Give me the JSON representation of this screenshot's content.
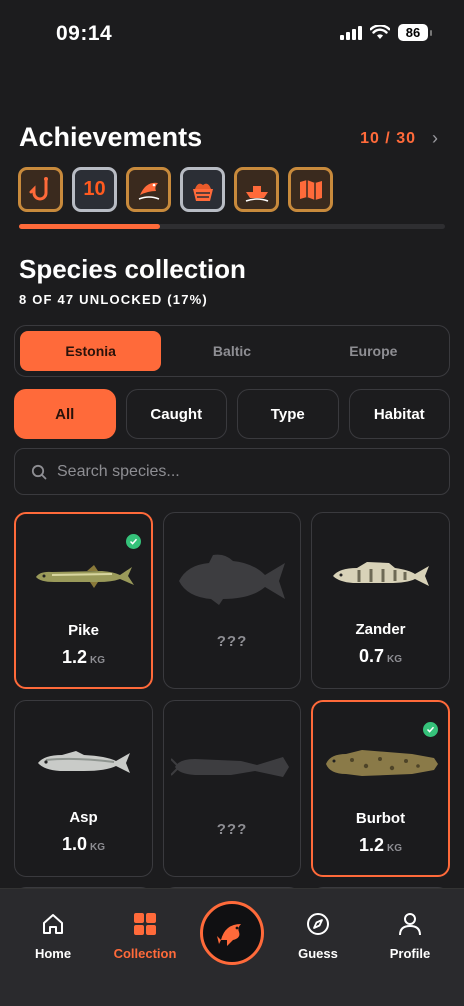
{
  "status": {
    "time": "09:14",
    "battery": "86"
  },
  "achievements": {
    "title": "Achievements",
    "count": "10 / 30",
    "progress": 0.33,
    "badges": [
      {
        "icon": "hook-icon",
        "style": "bronze"
      },
      {
        "icon": "ten-icon",
        "text": "10",
        "style": "silver"
      },
      {
        "icon": "jumping-fish-icon",
        "style": "bronze"
      },
      {
        "icon": "fish-basket-icon",
        "style": "silver"
      },
      {
        "icon": "boat-icon",
        "style": "bronze"
      },
      {
        "icon": "map-icon",
        "style": "bronze"
      }
    ]
  },
  "species": {
    "title": "Species collection",
    "subtitle": "8 OF 47 UNLOCKED (17%)"
  },
  "regions": [
    "Estonia",
    "Baltic",
    "Europe"
  ],
  "active_region": "Estonia",
  "filters": [
    "All",
    "Caught",
    "Type",
    "Habitat"
  ],
  "active_filter": "All",
  "search": {
    "placeholder": "Search species..."
  },
  "cards": [
    {
      "name": "Pike",
      "weight": "1.2",
      "unit": "KG",
      "caught": true
    },
    {
      "name": "???",
      "locked": true
    },
    {
      "name": "Zander",
      "weight": "0.7",
      "unit": "KG",
      "caught": false
    },
    {
      "name": "Asp",
      "weight": "1.0",
      "unit": "KG",
      "caught": false
    },
    {
      "name": "???",
      "locked": true
    },
    {
      "name": "Burbot",
      "weight": "1.2",
      "unit": "KG",
      "caught": true
    }
  ],
  "tabs": {
    "home": "Home",
    "collection": "Collection",
    "guess": "Guess",
    "profile": "Profile"
  }
}
